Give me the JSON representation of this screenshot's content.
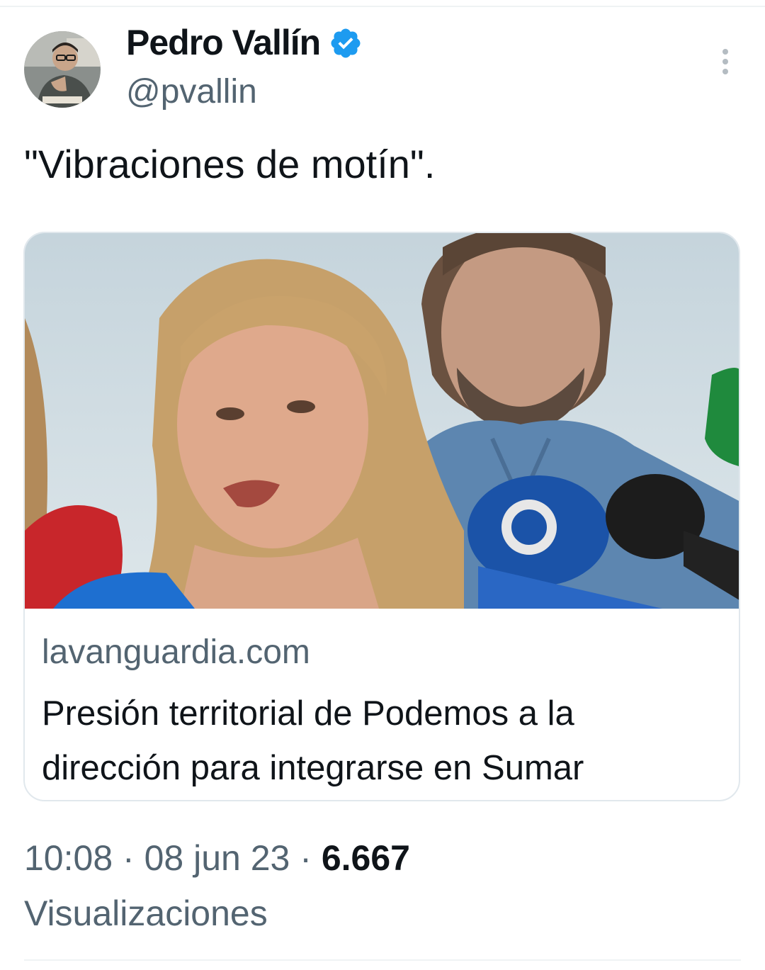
{
  "tweet": {
    "author": {
      "name": "Pedro Vallín",
      "handle": "@pvallin",
      "verified": true,
      "verified_color": "#1d9bf0"
    },
    "text": "\"Vibraciones de motín\".",
    "card": {
      "domain": "lavanguardia.com",
      "title": "Presión territorial de Podemos a la dirección para integrarse en Sumar"
    },
    "meta": {
      "time": "10:08",
      "separator": "·",
      "date": "08 jun 23",
      "views_count": "6.667",
      "views_label": "Visualizaciones"
    },
    "icons": {
      "more": "more-dots-icon",
      "verified": "verified-badge-icon"
    }
  }
}
